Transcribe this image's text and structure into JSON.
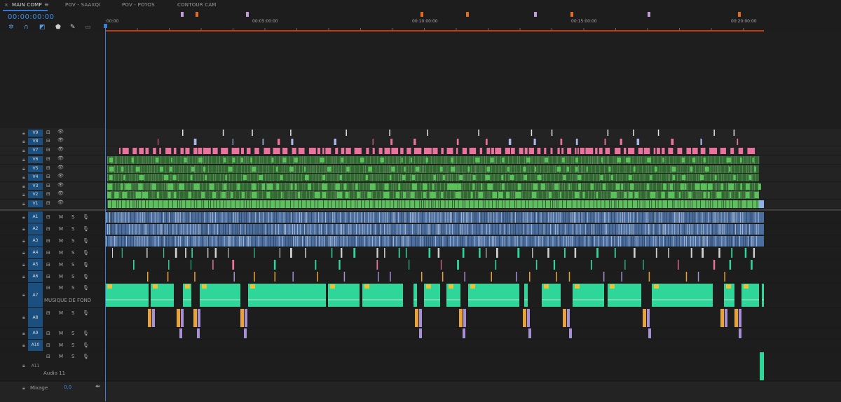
{
  "tabs": [
    {
      "label": "MAIN COMP",
      "active": true
    },
    {
      "label": "POV - SAAXQI",
      "active": false
    },
    {
      "label": "POV - POYOS",
      "active": false
    },
    {
      "label": "CONTOUR CAM",
      "active": false
    }
  ],
  "tab_close": "×",
  "tab_menu": "≡",
  "timecode": "00:00:00:00",
  "ruler": {
    "labels": [
      ":00:00",
      "00:05:00:00",
      "00:10:00:00",
      "00:15:00:00",
      "00:20:00:00"
    ]
  },
  "video_tracks": [
    "V9",
    "V8",
    "V7",
    "V6",
    "V5",
    "V4",
    "V3",
    "V2",
    "V1"
  ],
  "audio_tracks": [
    {
      "id": "A1",
      "name": ""
    },
    {
      "id": "A2",
      "name": ""
    },
    {
      "id": "A3",
      "name": ""
    },
    {
      "id": "A4",
      "name": ""
    },
    {
      "id": "A5",
      "name": ""
    },
    {
      "id": "A6",
      "name": ""
    },
    {
      "id": "A7",
      "name": "MUSIQUE DE FOND"
    },
    {
      "id": "A8",
      "name": ""
    },
    {
      "id": "A9",
      "name": ""
    },
    {
      "id": "A10",
      "name": ""
    },
    {
      "id": "A11",
      "name": "Audio 11"
    }
  ],
  "mute_label": "M",
  "solo_label": "S",
  "mix": {
    "label": "Mixage",
    "value": "0,0"
  },
  "colors": {
    "accent": "#3d8ee8",
    "pink": "#e9739e",
    "green_dark": "#2f6a2f",
    "green": "#5bc25b",
    "blue_audio": "#4a6fa0",
    "teal_audio": "#2fd69a",
    "orange": "#e7a33a",
    "lavender": "#a78fd4",
    "marker_orange": "#e36b1c",
    "marker_lavender": "#c49ad9",
    "workbar": "#c33a14"
  }
}
